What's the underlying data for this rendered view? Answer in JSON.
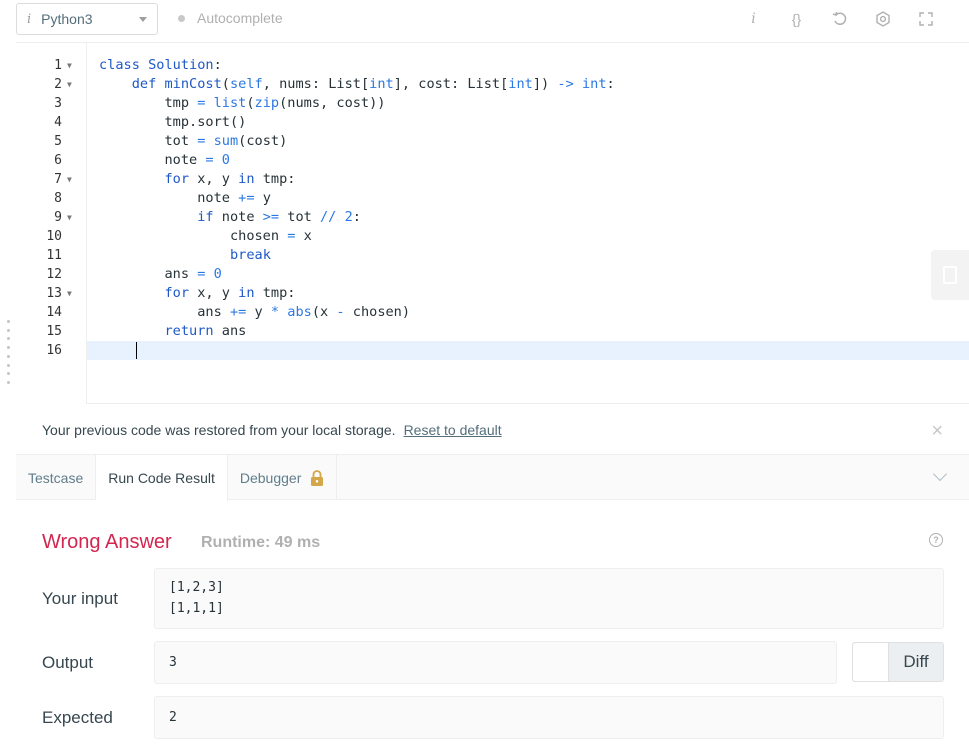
{
  "toolbar": {
    "language": "Python3",
    "autocomplete_label": "Autocomplete",
    "icons": [
      "info-icon",
      "braces-icon",
      "reset-icon",
      "settings-icon",
      "fullscreen-icon"
    ]
  },
  "editor": {
    "line_numbers": [
      "1",
      "2",
      "3",
      "4",
      "5",
      "6",
      "7",
      "8",
      "9",
      "10",
      "11",
      "12",
      "13",
      "14",
      "15",
      "16"
    ],
    "fold_lines": [
      1,
      2,
      7,
      9,
      13
    ],
    "active_line": 16,
    "lines": [
      [
        [
          "class ",
          "kw"
        ],
        [
          "Solution",
          "cls"
        ],
        [
          ":",
          "plain"
        ]
      ],
      [
        [
          "    ",
          "plain"
        ],
        [
          "def ",
          "kw"
        ],
        [
          "minCost",
          "fn"
        ],
        [
          "(",
          "plain"
        ],
        [
          "self",
          "blue"
        ],
        [
          ", nums: List[",
          "plain"
        ],
        [
          "int",
          "blue"
        ],
        [
          "], cost: List[",
          "plain"
        ],
        [
          "int",
          "blue"
        ],
        [
          "]) ",
          "plain"
        ],
        [
          "->",
          "blue"
        ],
        [
          " ",
          "plain"
        ],
        [
          "int",
          "blue"
        ],
        [
          ":",
          "plain"
        ]
      ],
      [
        [
          "        tmp ",
          "plain"
        ],
        [
          "=",
          "blue"
        ],
        [
          " ",
          "plain"
        ],
        [
          "list",
          "blue"
        ],
        [
          "(",
          "plain"
        ],
        [
          "zip",
          "blue"
        ],
        [
          "(nums, cost))",
          "plain"
        ]
      ],
      [
        [
          "        tmp.sort()",
          "plain"
        ]
      ],
      [
        [
          "        tot ",
          "plain"
        ],
        [
          "=",
          "blue"
        ],
        [
          " ",
          "plain"
        ],
        [
          "sum",
          "blue"
        ],
        [
          "(cost)",
          "plain"
        ]
      ],
      [
        [
          "        note ",
          "plain"
        ],
        [
          "=",
          "blue"
        ],
        [
          " ",
          "plain"
        ],
        [
          "0",
          "blue"
        ]
      ],
      [
        [
          "        ",
          "plain"
        ],
        [
          "for",
          "kw"
        ],
        [
          " x, y ",
          "plain"
        ],
        [
          "in",
          "kw"
        ],
        [
          " tmp:",
          "plain"
        ]
      ],
      [
        [
          "            note ",
          "plain"
        ],
        [
          "+=",
          "blue"
        ],
        [
          " y",
          "plain"
        ]
      ],
      [
        [
          "            ",
          "plain"
        ],
        [
          "if",
          "kw"
        ],
        [
          " note ",
          "plain"
        ],
        [
          ">=",
          "blue"
        ],
        [
          " tot ",
          "plain"
        ],
        [
          "//",
          "blue"
        ],
        [
          " ",
          "plain"
        ],
        [
          "2",
          "blue"
        ],
        [
          ":",
          "plain"
        ]
      ],
      [
        [
          "                chosen ",
          "plain"
        ],
        [
          "=",
          "blue"
        ],
        [
          " x",
          "plain"
        ]
      ],
      [
        [
          "                ",
          "plain"
        ],
        [
          "break",
          "kw"
        ]
      ],
      [
        [
          "        ans ",
          "plain"
        ],
        [
          "=",
          "blue"
        ],
        [
          " ",
          "plain"
        ],
        [
          "0",
          "blue"
        ]
      ],
      [
        [
          "        ",
          "plain"
        ],
        [
          "for",
          "kw"
        ],
        [
          " x, y ",
          "plain"
        ],
        [
          "in",
          "kw"
        ],
        [
          " tmp:",
          "plain"
        ]
      ],
      [
        [
          "            ans ",
          "plain"
        ],
        [
          "+=",
          "blue"
        ],
        [
          " y ",
          "plain"
        ],
        [
          "*",
          "blue"
        ],
        [
          " ",
          "plain"
        ],
        [
          "abs",
          "blue"
        ],
        [
          "(x ",
          "plain"
        ],
        [
          "-",
          "blue"
        ],
        [
          " chosen)",
          "plain"
        ]
      ],
      [
        [
          "        ",
          "plain"
        ],
        [
          "return",
          "kw"
        ],
        [
          " ans",
          "plain"
        ]
      ],
      [
        [
          "",
          "plain"
        ]
      ]
    ]
  },
  "notice": {
    "message": "Your previous code was restored from your local storage.",
    "reset_label": "Reset to default",
    "close_symbol": "×"
  },
  "tabs": {
    "testcase": "Testcase",
    "run_result": "Run Code Result",
    "debugger": "Debugger",
    "active": "Run Code Result"
  },
  "result": {
    "verdict": "Wrong Answer",
    "runtime": "Runtime: 49 ms",
    "help_symbol": "?",
    "input_label": "Your input",
    "input_lines": [
      "[1,2,3]",
      "[1,1,1]"
    ],
    "output_label": "Output",
    "output_value": "3",
    "expected_label": "Expected",
    "expected_value": "2",
    "diff_label": "Diff"
  },
  "colors": {
    "wrong": "#d3264e",
    "keyword": "#1e58c8",
    "builtin": "#2b78e4",
    "active_line": "#e8f2ff"
  }
}
